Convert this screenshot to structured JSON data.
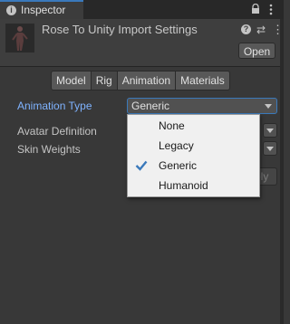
{
  "window": {
    "tab_title": "Inspector",
    "tab_icon_glyph": "i"
  },
  "header": {
    "title": "Rose To Unity Import Settings",
    "open_label": "Open",
    "help_glyph": "?",
    "settings_glyph": "⇄",
    "more_glyph": "⋮"
  },
  "tabs": [
    {
      "label": "Model",
      "active": false
    },
    {
      "label": "Rig",
      "active": true
    },
    {
      "label": "Animation",
      "active": false
    },
    {
      "label": "Materials",
      "active": false
    }
  ],
  "properties": {
    "animation_type_label": "Animation Type",
    "animation_type_value": "Generic",
    "avatar_definition_label": "Avatar Definition",
    "skin_weights_label": "Skin Weights",
    "apply_label": "ply"
  },
  "popup": {
    "options": [
      {
        "label": "None",
        "selected": false
      },
      {
        "label": "Legacy",
        "selected": false
      },
      {
        "label": "Generic",
        "selected": true
      },
      {
        "label": "Humanoid",
        "selected": false
      }
    ]
  },
  "colors": {
    "accent": "#3a79bb",
    "highlight_label": "#7fb3ff",
    "panel_bg": "#383838"
  },
  "icons": [
    "info-icon",
    "lock-icon",
    "menu-icon",
    "help-icon",
    "settings-icon",
    "more-icon",
    "check-icon",
    "chevron-down-icon"
  ]
}
